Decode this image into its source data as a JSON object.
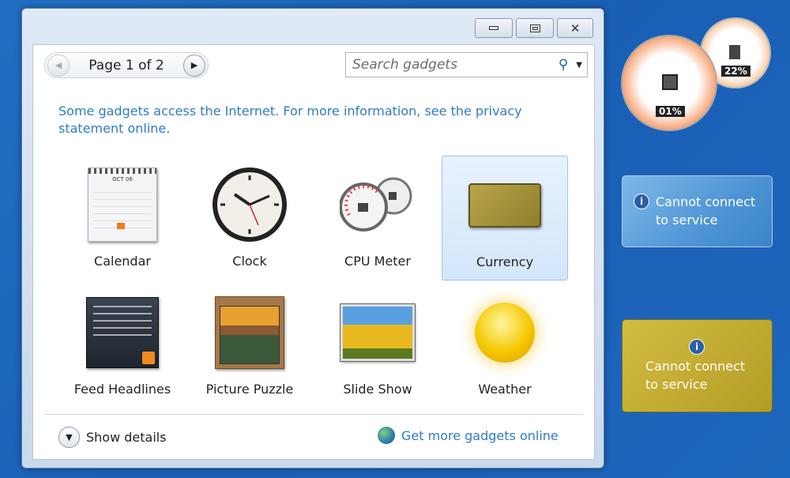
{
  "window": {
    "minimize_icon": "minimize-icon",
    "maximize_icon": "maximize-icon",
    "close_icon": "close-icon"
  },
  "nav": {
    "page_label": "Page 1 of 2"
  },
  "search": {
    "placeholder": "Search gadgets"
  },
  "info_text": "Some gadgets access the Internet.  For more information, see the privacy statement online.",
  "gadgets": [
    {
      "label": "Calendar"
    },
    {
      "label": "Clock"
    },
    {
      "label": "CPU Meter"
    },
    {
      "label": "Currency",
      "selected": true
    },
    {
      "label": "Feed Headlines"
    },
    {
      "label": "Picture Puzzle"
    },
    {
      "label": "Slide Show"
    },
    {
      "label": "Weather"
    }
  ],
  "calendar_month": "OCT 06",
  "footer": {
    "show_details": "Show details",
    "get_more": "Get more gadgets online"
  },
  "desktop": {
    "cpu_value": "01%",
    "memory_value": "22%",
    "tile1_text": "Cannot connect to service",
    "tile2_text": "Cannot connect to service"
  }
}
